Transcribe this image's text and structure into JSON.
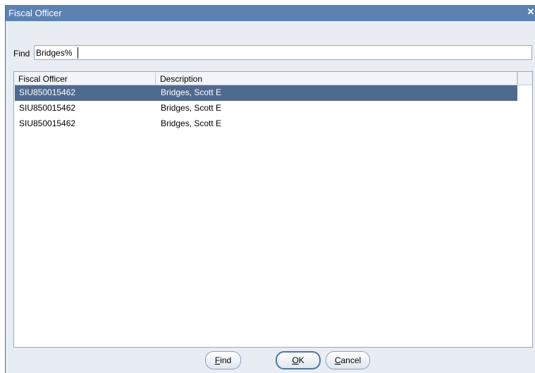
{
  "dialog": {
    "title": "Fiscal Officer",
    "close_glyph": "✕"
  },
  "find": {
    "label": "Find",
    "value": "Bridges%"
  },
  "list": {
    "columns": [
      "Fiscal Officer",
      "Description"
    ],
    "rows": [
      {
        "officer": "SIU850015462",
        "description": "Bridges, Scott E",
        "selected": true
      },
      {
        "officer": "SIU850015462",
        "description": "Bridges, Scott E",
        "selected": false
      },
      {
        "officer": "SIU850015462",
        "description": "Bridges, Scott E",
        "selected": false
      }
    ]
  },
  "buttons": {
    "find_access": "F",
    "find_rest": "ind",
    "ok_access": "O",
    "ok_rest": "K",
    "cancel_access": "C",
    "cancel_rest": "ancel"
  },
  "colors": {
    "titlebar": "#5b82b1",
    "selected_row": "#4f6a8f",
    "dialog_bg": "#e8edf3"
  },
  "icons": {
    "close": "close-icon"
  }
}
